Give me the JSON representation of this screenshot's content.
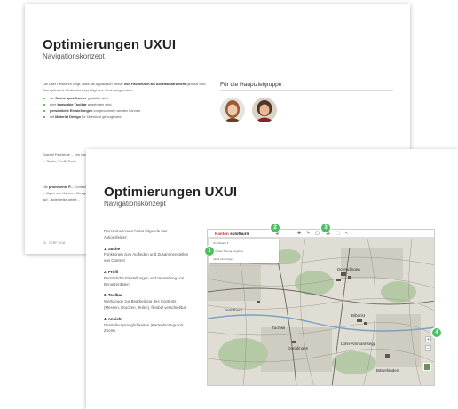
{
  "back_slide": {
    "title": "Optimierungen UXUI",
    "subtitle": "Navigationskonzept",
    "intro_pre": "Die User Research zeigt, dass die Applikation primär ",
    "intro_bold1": "von Fachleuten als Arbeitsinstrument",
    "intro_post": " genutzt wird. Das optimierte Bedienkonzept trägt dem Rechnung, indem:",
    "bullets": [
      {
        "pre": "die ",
        "bold": "Suche spezifischer",
        "post": " gestaltet wird."
      },
      {
        "pre": "eine ",
        "bold": "kompakte Toolbar",
        "post": " angeboten wird."
      },
      {
        "pre": "",
        "bold": "persönliche Einstellungen",
        "post": " vorgenommen werden können."
      },
      {
        "pre": "mit ",
        "bold": "Material Design",
        "post": " für Übersicht gesorgt wird."
      }
    ],
    "para2": "Sowohl Fachleute ... ren von der klaren ... Suche, Profil, Tool...",
    "para3_pre": "Die ",
    "para3_bold": "prominente P...",
    "para3_rest": " Content geht. Die ... fügen von Karten... Design) bauen auf... spielweise arbeit...",
    "section_title": "Für die Hauptzielgruppe",
    "footer_page": "15",
    "footer_copy": "©EBP 2018"
  },
  "front_slide": {
    "title": "Optimierungen UXUI",
    "subtitle": "Navigationskonzept",
    "intro": "Der Homescreen bietet folgende vier Aktionsfelder:",
    "features": [
      {
        "title": "1. Suche",
        "desc": "Funktionen zum Auffinden und Zusammenstellen von Content"
      },
      {
        "title": "2. Profil",
        "desc": "Persönliche Einstellungen und Verwaltung von Benutzerdaten"
      },
      {
        "title": "3. Toolbar",
        "desc": "Werkzeuge zur Bearbeitung des Contents (Messen, Drucken, Teilen), flexibel verschiebbar"
      },
      {
        "title": "4. Ansicht",
        "desc": "Darstellungsmöglichkeiten (Kartenhintergrund, Zoom)"
      }
    ],
    "map": {
      "logo_prefix": "Kanton",
      "logo_name": "solothurn",
      "panel_rows": [
        "Grundkarte ▾",
        "Ort oder Thema eingeben",
        "Inhalt hinzufügen"
      ],
      "zoom_in": "+",
      "zoom_out": "−",
      "markers": [
        "1",
        "2",
        "3",
        "4"
      ],
      "places": [
        "Solothurn",
        "Derendingen",
        "Zuchwil",
        "Biberist",
        "Gerlafingen",
        "Lohn-Ammannsegg",
        "Bätterkinden"
      ]
    }
  },
  "colors": {
    "accent_green": "#4fbf65",
    "brand_red": "#c33333"
  }
}
